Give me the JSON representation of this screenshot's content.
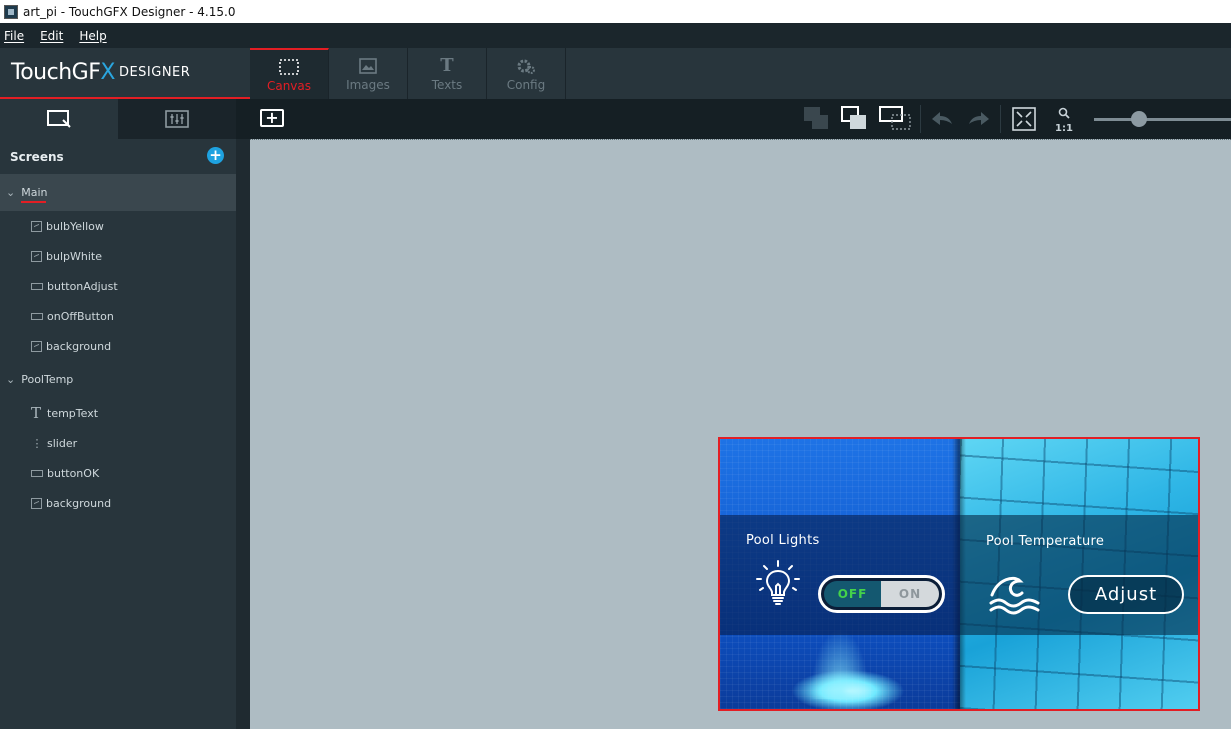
{
  "window": {
    "title": "art_pi - TouchGFX Designer - 4.15.0"
  },
  "menu": {
    "file": "File",
    "edit": "Edit",
    "help": "Help"
  },
  "logo": {
    "brand_a": "TouchGF",
    "brand_x": "X",
    "designer": "DESIGNER"
  },
  "tabs": [
    {
      "label": "Canvas",
      "active": true
    },
    {
      "label": "Images"
    },
    {
      "label": "Texts"
    },
    {
      "label": "Config"
    }
  ],
  "toolbar": {
    "zoom_label": "1:1"
  },
  "sidebar": {
    "screens_label": "Screens",
    "screens": [
      {
        "name": "Main",
        "selected": true,
        "widgets": [
          {
            "label": "bulbYellow",
            "icon": "image-icon"
          },
          {
            "label": "bulpWhite",
            "icon": "image-icon"
          },
          {
            "label": "buttonAdjust",
            "icon": "button-icon"
          },
          {
            "label": "onOffButton",
            "icon": "button-icon"
          },
          {
            "label": "background",
            "icon": "image-icon"
          }
        ]
      },
      {
        "name": "PoolTemp",
        "widgets": [
          {
            "label": "tempText",
            "icon": "text-icon"
          },
          {
            "label": "slider",
            "icon": "slider-icon"
          },
          {
            "label": "buttonOK",
            "icon": "button-icon"
          },
          {
            "label": "background",
            "icon": "image-icon"
          }
        ]
      }
    ]
  },
  "device": {
    "pool_lights": "Pool Lights",
    "pool_temperature": "Pool Temperature",
    "toggle_off": "OFF",
    "toggle_on": "ON",
    "adjust": "Adjust"
  },
  "colors": {
    "accent": "#e31e24",
    "add_blue": "#1ea2e0",
    "canvas": "#aebcc3"
  }
}
